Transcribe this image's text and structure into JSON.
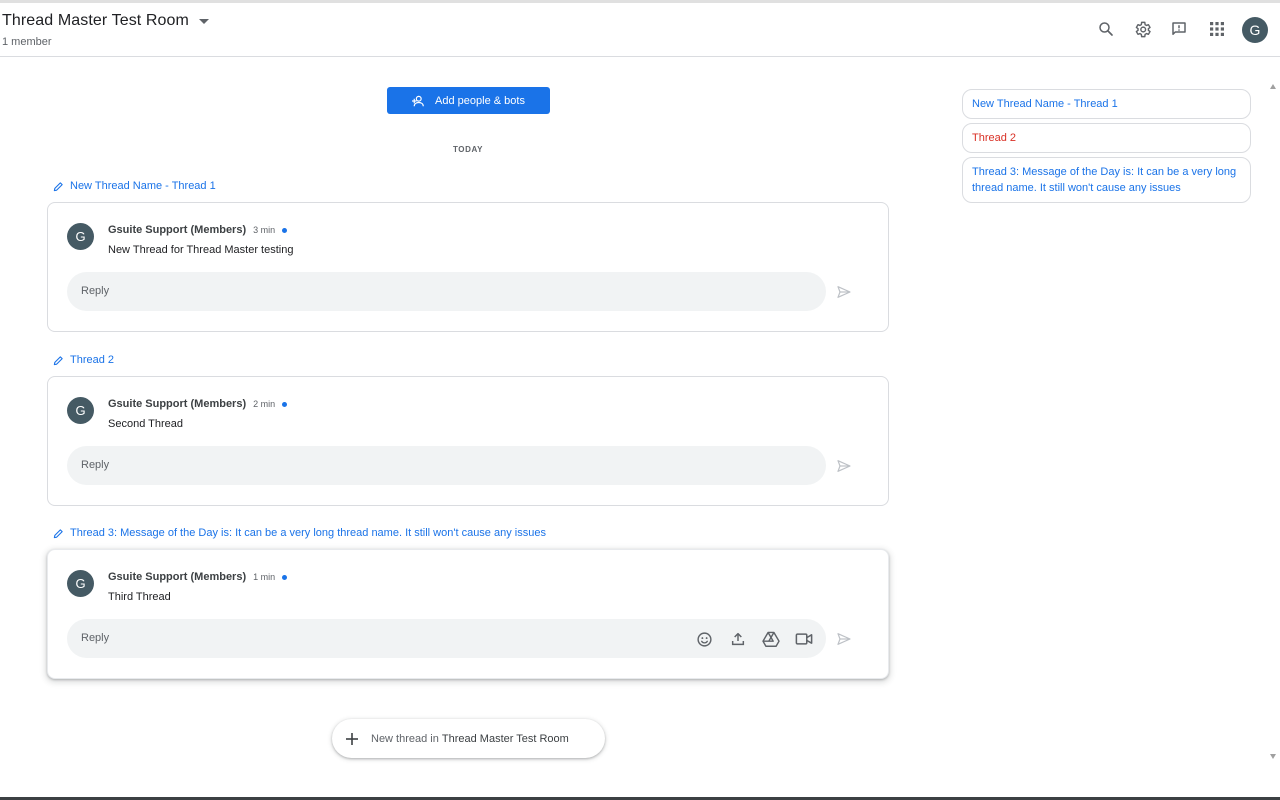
{
  "header": {
    "room_name": "Thread Master Test Room",
    "member_count": "1 member",
    "avatar_initial": "G",
    "icons": [
      "search-icon",
      "settings-icon",
      "feedback-icon",
      "apps-icon"
    ]
  },
  "add_people": {
    "label": "Add people & bots"
  },
  "divider": {
    "label": "TODAY"
  },
  "threads": [
    {
      "title": "New Thread Name - Thread 1",
      "sender": "Gsuite Support (Members)",
      "avatar_initial": "G",
      "time": "3 min",
      "text": "New Thread for Thread Master testing",
      "reply_placeholder": "Reply"
    },
    {
      "title": "Thread 2",
      "sender": "Gsuite Support (Members)",
      "avatar_initial": "G",
      "time": "2 min",
      "text": "Second Thread",
      "reply_placeholder": "Reply"
    },
    {
      "title": "Thread 3: Message of the Day is: It can be a very long thread name. It still won't cause any issues",
      "sender": "Gsuite Support (Members)",
      "avatar_initial": "G",
      "time": "1 min",
      "text": "Third Thread",
      "reply_placeholder": "Reply",
      "tools": [
        "emoji-icon",
        "upload-icon",
        "drive-icon",
        "video-icon"
      ]
    }
  ],
  "new_thread": {
    "prefix": "New thread in",
    "room": "Thread Master Test Room"
  },
  "thread_nav": {
    "items": [
      "New Thread Name - Thread 1",
      "Thread 2",
      "Thread 3: Message of the Day is: It can be a very long thread name. It still won't cause any issues"
    ],
    "current_index": 1
  },
  "colors": {
    "accent": "#1a73e8",
    "current_thread": "#d93025",
    "avatar": "#455a64",
    "reply_bg": "#f1f3f4"
  }
}
